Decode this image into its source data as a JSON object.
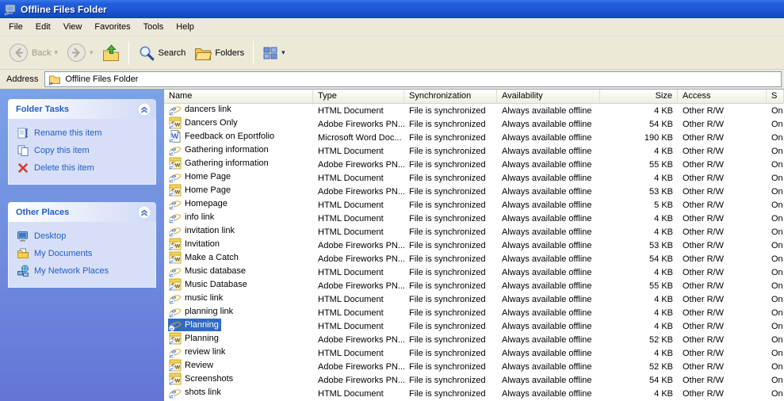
{
  "window": {
    "title": "Offline Files Folder"
  },
  "colors": {
    "titlebar_blue": "#1c57d8",
    "toolbar_bg": "#ece9d8",
    "sidebar_top": "#7ba2e7",
    "sidebar_bottom": "#6375d6",
    "panel_body": "#d6dff7",
    "link_blue": "#215dc6",
    "selection": "#316ac5"
  },
  "menubar": {
    "items": [
      {
        "label": "File"
      },
      {
        "label": "Edit"
      },
      {
        "label": "View"
      },
      {
        "label": "Favorites"
      },
      {
        "label": "Tools"
      },
      {
        "label": "Help"
      }
    ]
  },
  "toolbar": {
    "back_label": "Back",
    "search_label": "Search",
    "folders_label": "Folders"
  },
  "address": {
    "label": "Address",
    "value": "Offline Files Folder"
  },
  "sidebar": {
    "panels": [
      {
        "title": "Folder Tasks",
        "items": [
          {
            "label": "Rename this item",
            "icon": "rename-icon"
          },
          {
            "label": "Copy this item",
            "icon": "copy-icon"
          },
          {
            "label": "Delete this item",
            "icon": "delete-icon"
          }
        ]
      },
      {
        "title": "Other Places",
        "items": [
          {
            "label": "Desktop",
            "icon": "desktop-icon"
          },
          {
            "label": "My Documents",
            "icon": "my-documents-icon"
          },
          {
            "label": "My Network Places",
            "icon": "network-icon"
          }
        ]
      }
    ]
  },
  "file_list": {
    "columns": [
      {
        "label": "Name"
      },
      {
        "label": "Type"
      },
      {
        "label": "Synchronization"
      },
      {
        "label": "Availability"
      },
      {
        "label": "Size"
      },
      {
        "label": "Access"
      },
      {
        "label": "S"
      }
    ],
    "rows": [
      {
        "name": "dancers link",
        "icon": "html",
        "type": "HTML Document",
        "sync": "File is synchronized",
        "availability": "Always available offline",
        "size": "4 KB",
        "access": "Other R/W",
        "status": "On",
        "selected": false
      },
      {
        "name": "Dancers Only",
        "icon": "fireworks",
        "type": "Adobe Fireworks PN...",
        "sync": "File is synchronized",
        "availability": "Always available offline",
        "size": "54 KB",
        "access": "Other R/W",
        "status": "On",
        "selected": false
      },
      {
        "name": "Feedback on Eportfolio",
        "icon": "word",
        "type": "Microsoft Word Doc...",
        "sync": "File is synchronized",
        "availability": "Always available offline",
        "size": "190 KB",
        "access": "Other R/W",
        "status": "On",
        "selected": false
      },
      {
        "name": "Gathering information",
        "icon": "html",
        "type": "HTML Document",
        "sync": "File is synchronized",
        "availability": "Always available offline",
        "size": "4 KB",
        "access": "Other R/W",
        "status": "On",
        "selected": false
      },
      {
        "name": "Gathering information",
        "icon": "fireworks",
        "type": "Adobe Fireworks PN...",
        "sync": "File is synchronized",
        "availability": "Always available offline",
        "size": "55 KB",
        "access": "Other R/W",
        "status": "On",
        "selected": false
      },
      {
        "name": "Home Page",
        "icon": "html",
        "type": "HTML Document",
        "sync": "File is synchronized",
        "availability": "Always available offline",
        "size": "4 KB",
        "access": "Other R/W",
        "status": "On",
        "selected": false
      },
      {
        "name": "Home Page",
        "icon": "fireworks",
        "type": "Adobe Fireworks PN...",
        "sync": "File is synchronized",
        "availability": "Always available offline",
        "size": "53 KB",
        "access": "Other R/W",
        "status": "On",
        "selected": false
      },
      {
        "name": "Homepage",
        "icon": "html",
        "type": "HTML Document",
        "sync": "File is synchronized",
        "availability": "Always available offline",
        "size": "5 KB",
        "access": "Other R/W",
        "status": "On",
        "selected": false
      },
      {
        "name": "info link",
        "icon": "html",
        "type": "HTML Document",
        "sync": "File is synchronized",
        "availability": "Always available offline",
        "size": "4 KB",
        "access": "Other R/W",
        "status": "On",
        "selected": false
      },
      {
        "name": "invitation link",
        "icon": "html",
        "type": "HTML Document",
        "sync": "File is synchronized",
        "availability": "Always available offline",
        "size": "4 KB",
        "access": "Other R/W",
        "status": "On",
        "selected": false
      },
      {
        "name": "Invitation",
        "icon": "fireworks",
        "type": "Adobe Fireworks PN...",
        "sync": "File is synchronized",
        "availability": "Always available offline",
        "size": "53 KB",
        "access": "Other R/W",
        "status": "On",
        "selected": false
      },
      {
        "name": "Make a Catch",
        "icon": "fireworks",
        "type": "Adobe Fireworks PN...",
        "sync": "File is synchronized",
        "availability": "Always available offline",
        "size": "54 KB",
        "access": "Other R/W",
        "status": "On",
        "selected": false
      },
      {
        "name": "Music database",
        "icon": "html",
        "type": "HTML Document",
        "sync": "File is synchronized",
        "availability": "Always available offline",
        "size": "4 KB",
        "access": "Other R/W",
        "status": "On",
        "selected": false
      },
      {
        "name": "Music Database",
        "icon": "fireworks",
        "type": "Adobe Fireworks PN...",
        "sync": "File is synchronized",
        "availability": "Always available offline",
        "size": "55 KB",
        "access": "Other R/W",
        "status": "On",
        "selected": false
      },
      {
        "name": "music link",
        "icon": "html",
        "type": "HTML Document",
        "sync": "File is synchronized",
        "availability": "Always available offline",
        "size": "4 KB",
        "access": "Other R/W",
        "status": "On",
        "selected": false
      },
      {
        "name": "planning link",
        "icon": "html",
        "type": "HTML Document",
        "sync": "File is synchronized",
        "availability": "Always available offline",
        "size": "4 KB",
        "access": "Other R/W",
        "status": "On",
        "selected": false
      },
      {
        "name": "Planning",
        "icon": "html",
        "type": "HTML Document",
        "sync": "File is synchronized",
        "availability": "Always available offline",
        "size": "4 KB",
        "access": "Other R/W",
        "status": "On",
        "selected": true
      },
      {
        "name": "Planning",
        "icon": "fireworks",
        "type": "Adobe Fireworks PN...",
        "sync": "File is synchronized",
        "availability": "Always available offline",
        "size": "52 KB",
        "access": "Other R/W",
        "status": "On",
        "selected": false
      },
      {
        "name": "review link",
        "icon": "html",
        "type": "HTML Document",
        "sync": "File is synchronized",
        "availability": "Always available offline",
        "size": "4 KB",
        "access": "Other R/W",
        "status": "On",
        "selected": false
      },
      {
        "name": "Review",
        "icon": "fireworks",
        "type": "Adobe Fireworks PN...",
        "sync": "File is synchronized",
        "availability": "Always available offline",
        "size": "52 KB",
        "access": "Other R/W",
        "status": "On",
        "selected": false
      },
      {
        "name": "Screenshots",
        "icon": "fireworks",
        "type": "Adobe Fireworks PN...",
        "sync": "File is synchronized",
        "availability": "Always available offline",
        "size": "54 KB",
        "access": "Other R/W",
        "status": "On",
        "selected": false
      },
      {
        "name": "shots link",
        "icon": "html",
        "type": "HTML Document",
        "sync": "File is synchronized",
        "availability": "Always available offline",
        "size": "4 KB",
        "access": "Other R/W",
        "status": "On",
        "selected": false
      }
    ]
  }
}
